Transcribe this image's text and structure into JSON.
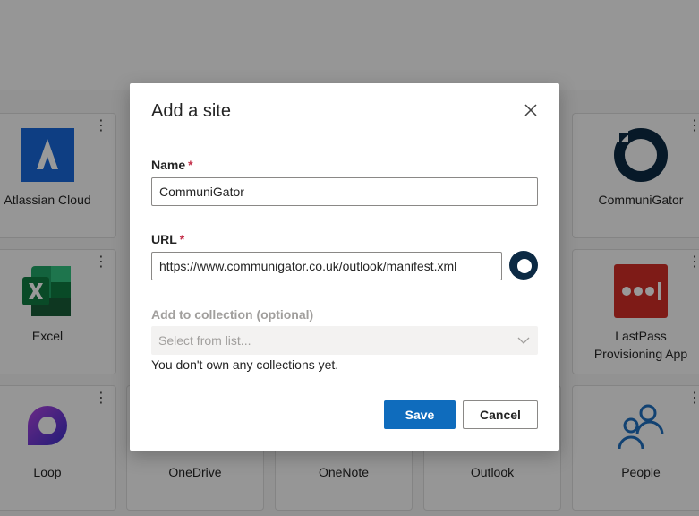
{
  "background": {
    "tiles": [
      {
        "label": "Atlassian Cloud",
        "icon": "atlassian-icon"
      },
      {
        "label": "CommuniGator",
        "icon": "communigator-icon"
      },
      {
        "label": "Excel",
        "icon": "excel-icon"
      },
      {
        "label": "LastPass Provisioning App",
        "icon": "lastpass-icon"
      },
      {
        "label": "Loop",
        "icon": "loop-icon"
      },
      {
        "label": "OneDrive",
        "icon": "onedrive-icon"
      },
      {
        "label": "OneNote",
        "icon": "onenote-icon"
      },
      {
        "label": "Outlook",
        "icon": "outlook-icon"
      },
      {
        "label": "People",
        "icon": "people-icon"
      }
    ],
    "more_glyph": "⋮"
  },
  "dialog": {
    "title": "Add a site",
    "name_label": "Name",
    "name_value": "CommuniGator",
    "url_label": "URL",
    "url_value": "https://www.communigator.co.uk/outlook/manifest.xml",
    "collection_label": "Add to collection (optional)",
    "collection_placeholder": "Select from list...",
    "collection_hint": "You don't own any collections yet.",
    "required_marker": "*",
    "save_label": "Save",
    "cancel_label": "Cancel"
  },
  "colors": {
    "primary": "#0f6cbd",
    "required": "#c4314b",
    "communigator": "#0c2a44",
    "lastpass": "#d32d27",
    "people": "#1f6fbf"
  }
}
